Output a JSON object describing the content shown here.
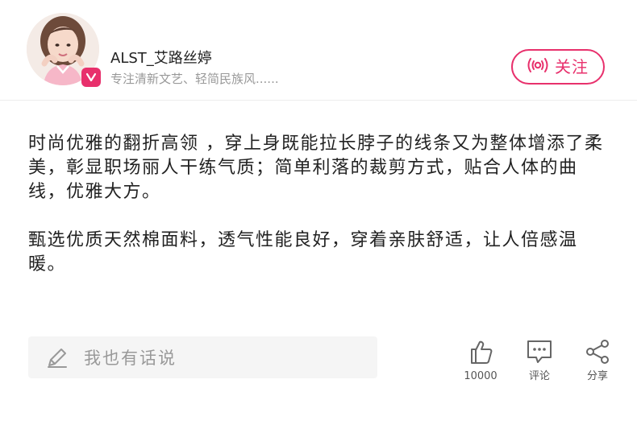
{
  "colors": {
    "accent": "#e8306c",
    "text": "#222222",
    "muted": "#999999",
    "icon": "#666666",
    "input_bg": "#f5f5f5"
  },
  "header": {
    "avatar_icon": "avatar",
    "badge_icon": "vip-chevron-icon",
    "username": "ALST_艾路丝婷",
    "bio": "专注清新文艺、轻简民族风......",
    "follow_label": "关注",
    "follow_icon": "broadcast-icon"
  },
  "content": {
    "paragraph_1": "时尚优雅的翻折高领 ，穿上身既能拉长脖子的线条又为整体增添了柔美，彰显职场丽人干练气质；简单利落的裁剪方式，贴合人体的曲线，优雅大方。",
    "paragraph_2": "甄选优质天然棉面料，透气性能良好，穿着亲肤舒适，让人倍感温暖。"
  },
  "footer": {
    "comment_placeholder": "我也有话说",
    "comment_icon": "pencil-icon",
    "like_count": "10000",
    "like_icon": "thumbs-up-icon",
    "comment_label": "评论",
    "comment_action_icon": "chat-bubble-icon",
    "share_label": "分享",
    "share_icon": "share-icon"
  }
}
